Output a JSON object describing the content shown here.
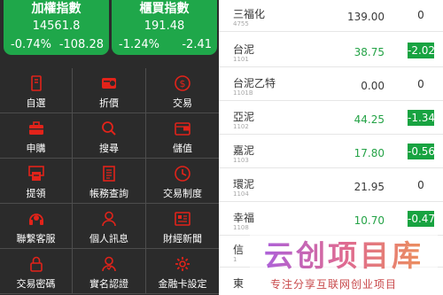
{
  "colors": {
    "card_bg": "#1fa74a",
    "negative": "#25a347",
    "menu_icon": "#e2231a",
    "left_bg": "#2b2b2b"
  },
  "index_cards": [
    {
      "name": "加權指數",
      "value": "14561.8",
      "pct": "-0.74%",
      "change": "-108.28"
    },
    {
      "name": "櫃買指數",
      "value": "191.48",
      "pct": "-1.24%",
      "change": "-2.41"
    }
  ],
  "menu": [
    {
      "label": "自選",
      "icon": "bookmark-icon"
    },
    {
      "label": "折價",
      "icon": "ticket-icon"
    },
    {
      "label": "交易",
      "icon": "dollar-circle-icon"
    },
    {
      "label": "申購",
      "icon": "briefcase-icon"
    },
    {
      "label": "搜尋",
      "icon": "search-icon"
    },
    {
      "label": "儲值",
      "icon": "wallet-icon"
    },
    {
      "label": "提領",
      "icon": "atm-icon"
    },
    {
      "label": "帳務查詢",
      "icon": "document-icon"
    },
    {
      "label": "交易制度",
      "icon": "clock-icon"
    },
    {
      "label": "聯繫客服",
      "icon": "headset-icon"
    },
    {
      "label": "個人訊息",
      "icon": "user-icon"
    },
    {
      "label": "財經新聞",
      "icon": "news-icon"
    },
    {
      "label": "交易密碼",
      "icon": "lock-icon"
    },
    {
      "label": "實名認證",
      "icon": "id-user-icon"
    },
    {
      "label": "金融卡設定",
      "icon": "gear-icon"
    }
  ],
  "stocks": [
    {
      "name": "三福化",
      "code": "4755",
      "price": "139.00",
      "change": "0",
      "dir": "flat"
    },
    {
      "name": "台泥",
      "code": "1101",
      "price": "38.75",
      "change": "-2.02",
      "dir": "neg"
    },
    {
      "name": "台泥乙特",
      "code": "1101B",
      "price": "0.00",
      "change": "0",
      "dir": "flat"
    },
    {
      "name": "亞泥",
      "code": "1102",
      "price": "44.25",
      "change": "-1.34",
      "dir": "neg"
    },
    {
      "name": "嘉泥",
      "code": "1103",
      "price": "17.80",
      "change": "-0.56",
      "dir": "neg"
    },
    {
      "name": "環泥",
      "code": "1104",
      "price": "21.95",
      "change": "0",
      "dir": "flat"
    },
    {
      "name": "幸福",
      "code": "1108",
      "price": "10.70",
      "change": "-0.47",
      "dir": "neg"
    },
    {
      "name": "信",
      "code": "1",
      "price": "",
      "change": "",
      "dir": "flat"
    },
    {
      "name": "東",
      "code": "",
      "price": "",
      "change": "",
      "dir": "flat"
    }
  ],
  "watermark": {
    "logo_text": "云创项目库",
    "tagline": "专注分享互联网创业项目"
  }
}
